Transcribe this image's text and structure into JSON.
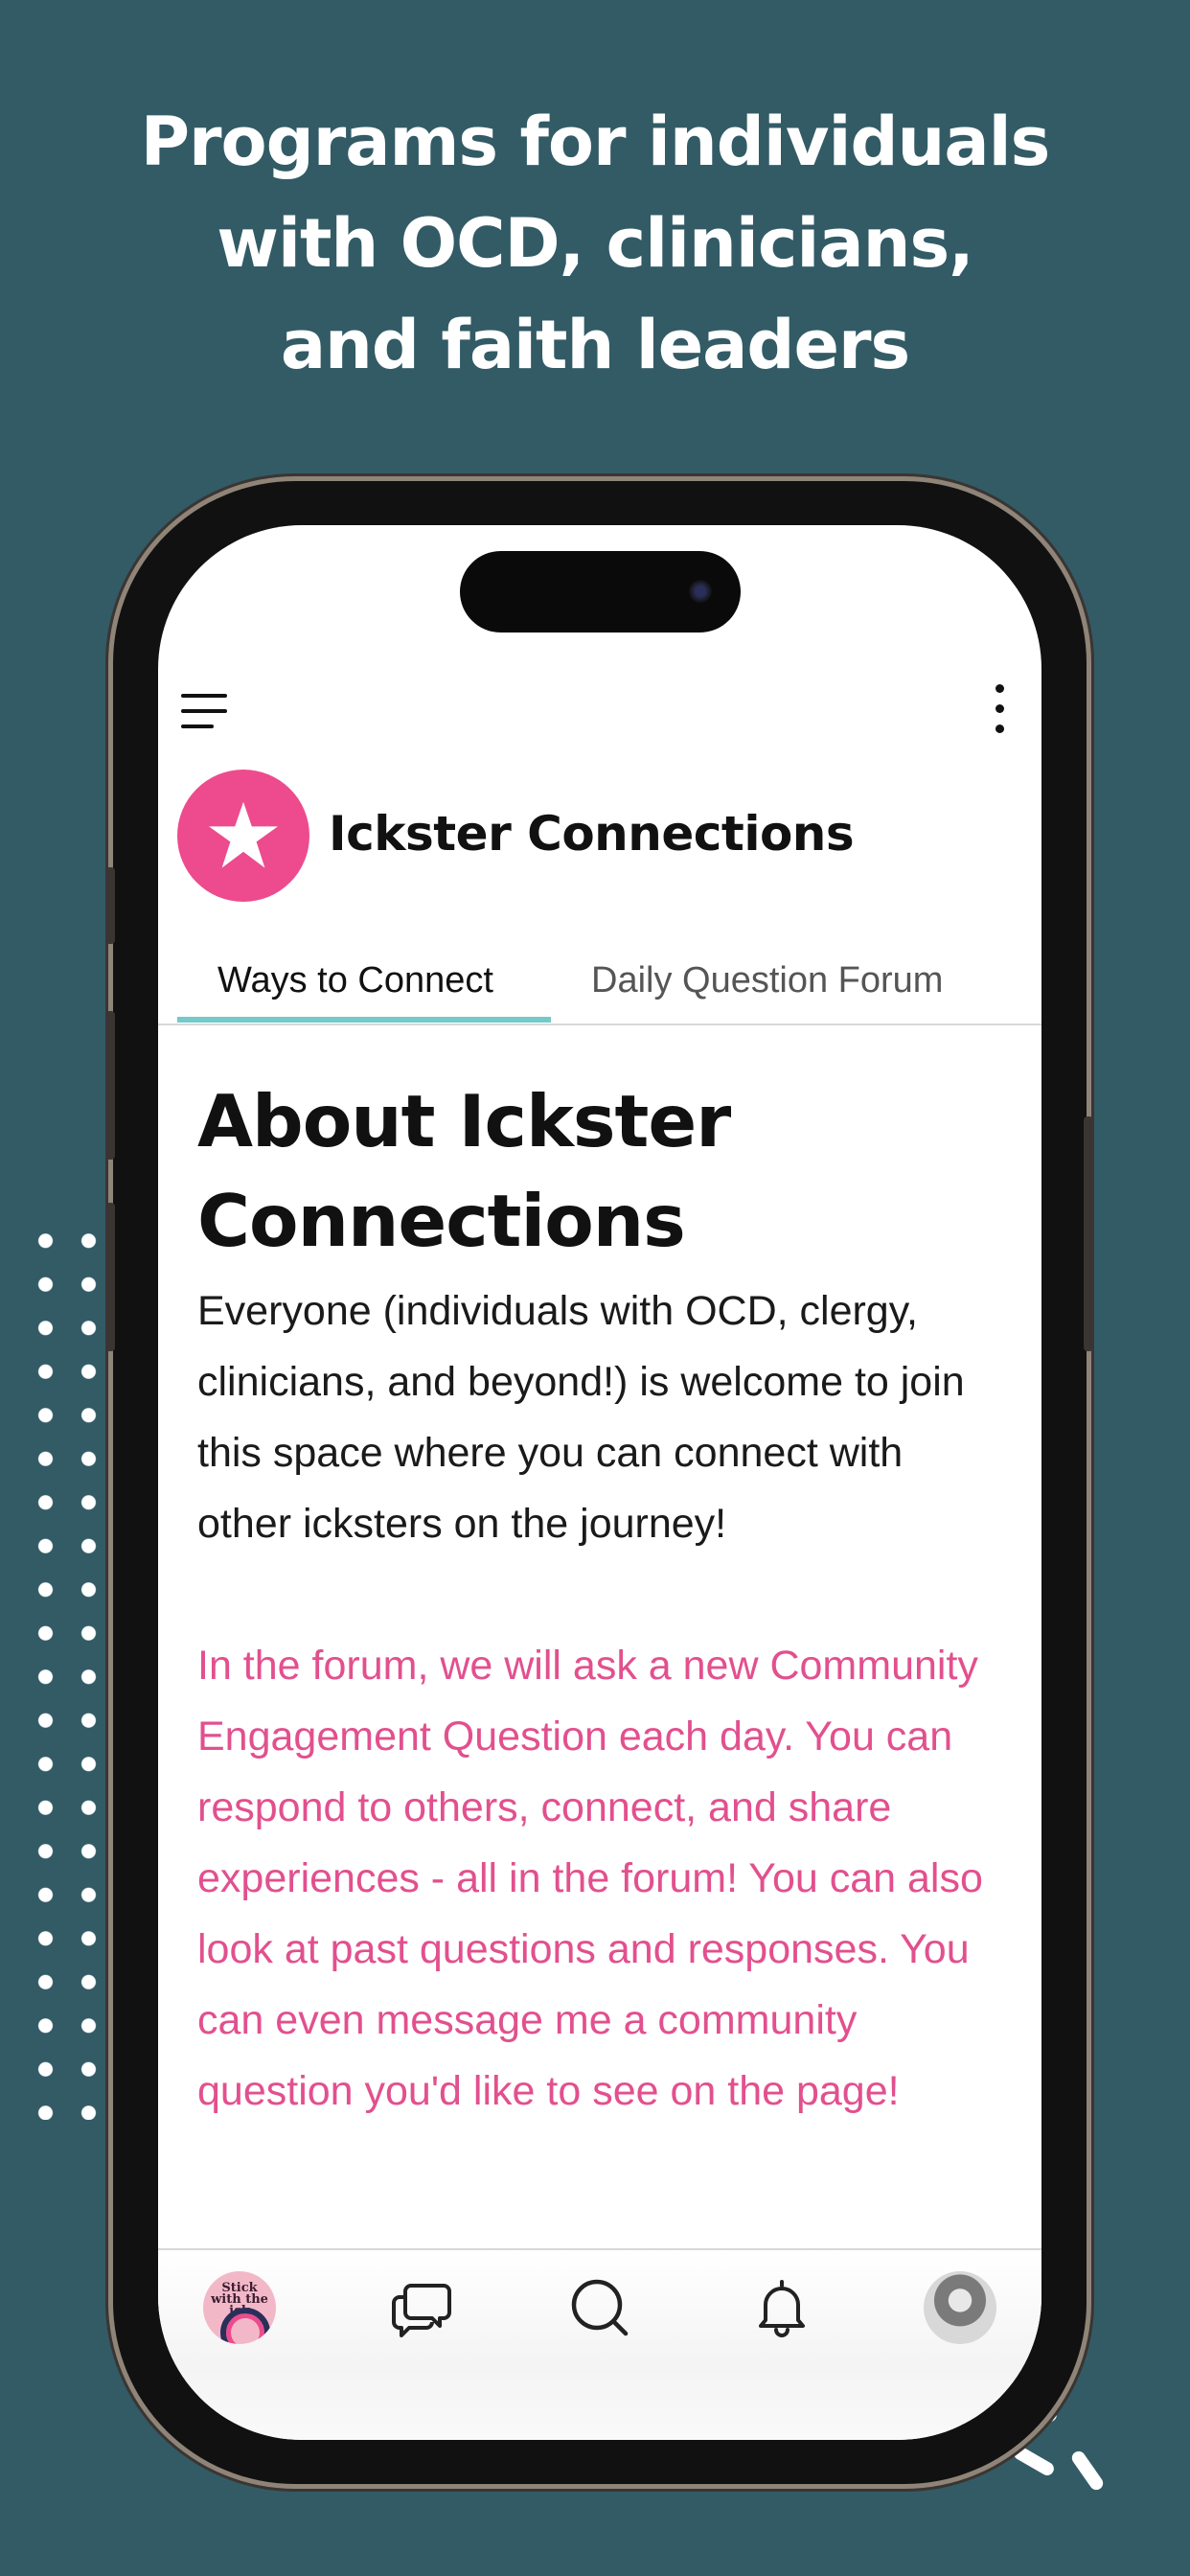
{
  "headline": {
    "line1": "Programs for individuals",
    "line2": "with OCD, clinicians,",
    "line3": "and faith leaders"
  },
  "app": {
    "group_title": "Ickster Connections",
    "tabs": [
      {
        "label": "Ways to Connect",
        "active": true
      },
      {
        "label": "Daily Question Forum",
        "active": false
      }
    ],
    "about": {
      "title_line1": "About Ickster",
      "title_line2": "Connections",
      "body": "Everyone (individuals with OCD, clergy, clinicians, and beyond!) is welcome to join this space where you can connect with other icksters on the journey!",
      "forum_note": "In the forum, we will ask a new Community Engagement Question each day. You can respond to others, connect, and share experiences - all in the forum! You can also look at past questions and responses. You can even message me a community question you'd like to see on the page!"
    },
    "bottom_nav": [
      {
        "icon": "community-logo",
        "logo_text": "Stick with the ick"
      },
      {
        "icon": "chat-bubbles-icon"
      },
      {
        "icon": "search-icon"
      },
      {
        "icon": "bell-icon"
      },
      {
        "icon": "profile-avatar"
      }
    ]
  },
  "colors": {
    "background": "#325b66",
    "accent_pink": "#ed4b8e",
    "tab_underline": "#75c9c9",
    "forum_text": "#e2508e"
  }
}
